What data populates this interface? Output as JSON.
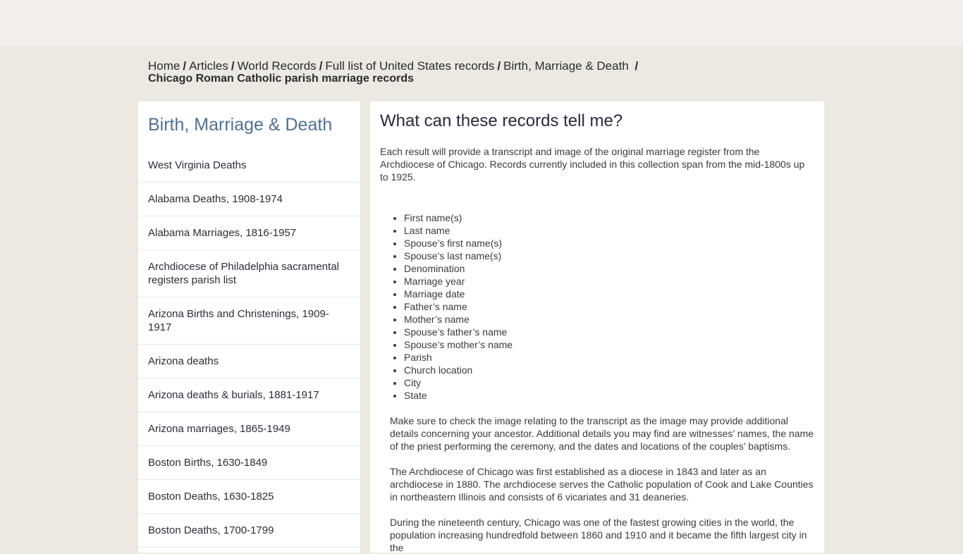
{
  "breadcrumb": {
    "items": [
      {
        "label": "Home"
      },
      {
        "label": "Articles"
      },
      {
        "label": "World Records"
      },
      {
        "label": "Full list of United States records"
      },
      {
        "label": "Birth, Marriage & Death"
      }
    ],
    "separator": "/",
    "current": "Chicago Roman Catholic parish marriage records"
  },
  "sidebar": {
    "title": "Birth, Marriage & Death",
    "items": [
      {
        "label": "West Virginia Deaths"
      },
      {
        "label": "Alabama Deaths, 1908-1974"
      },
      {
        "label": "Alabama Marriages, 1816-1957"
      },
      {
        "label": "Archdiocese of Philadelphia sacramental registers parish list"
      },
      {
        "label": "Arizona Births and Christenings, 1909-1917"
      },
      {
        "label": "Arizona deaths"
      },
      {
        "label": "Arizona deaths & burials, 1881-1917"
      },
      {
        "label": "Arizona marriages, 1865-1949"
      },
      {
        "label": "Boston Births, 1630-1849"
      },
      {
        "label": "Boston Deaths, 1630-1825"
      },
      {
        "label": "Boston Deaths, 1700-1799"
      }
    ]
  },
  "main": {
    "heading": "What can these records tell me?",
    "intro": "Each result will provide a transcript and image of the original marriage register from the Archdiocese of Chicago. Records currently included in this collection span from the mid-1800s up to 1925.",
    "fields": [
      "First name(s)",
      "Last name",
      "Spouse’s first name(s)",
      "Spouse’s last name(s)",
      "Denomination",
      "Marriage year",
      "Marriage date",
      "Father’s name",
      "Mother’s name",
      "Spouse’s father’s name",
      "Spouse’s mother’s name",
      "Parish",
      "Church location",
      "City",
      "State"
    ],
    "paragraphs": [
      "Make sure to check the image relating to the transcript as the image may provide additional details concerning your ancestor. Additional details you may find are witnesses’ names, the name of the priest performing the ceremony, and the dates and locations of the couples’ baptisms.",
      "The Archdiocese of Chicago was first established as a diocese in 1843 and later as an archdiocese in 1880. The archdiocese serves the Catholic population of Cook and Lake Counties in northeastern Illinois and consists of 6 vicariates and 31 deaneries.",
      "During the nineteenth century, Chicago was one of the fastest growing cities in the world, the population increasing hundredfold between 1860 and 1910 and it became the fifth largest city in the"
    ]
  },
  "colors": {
    "header_bg": "#f2efea",
    "page_bg": "#ece9e3",
    "sidebar_title": "#4f7196"
  }
}
